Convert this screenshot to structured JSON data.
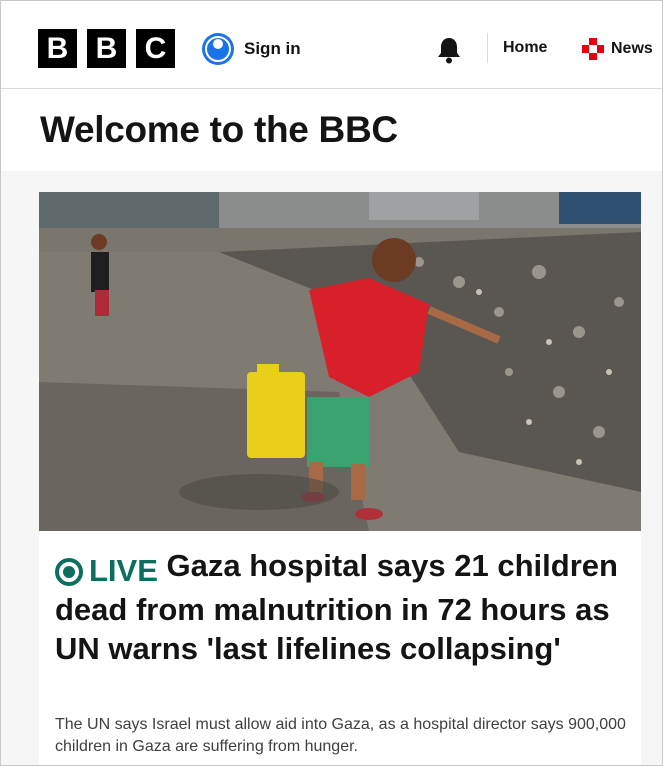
{
  "header": {
    "logo": [
      "B",
      "B",
      "C"
    ],
    "sign_in_label": "Sign in",
    "nav_home": "Home",
    "nav_news": "News",
    "icons": {
      "avatar": "user-icon",
      "bell": "notification-bell-icon",
      "news": "news-cross-icon"
    }
  },
  "welcome": {
    "title": "Welcome to the BBC"
  },
  "story": {
    "live_label": "LIVE",
    "headline": "Gaza hospital says 21 children dead from malnutrition in 72 hours as UN warns 'last lifelines collapsing'",
    "summary": "The UN says Israel must allow aid into Gaza, as a hospital director says 900,000 children in Gaza are suffering from hunger."
  },
  "colors": {
    "accent_live": "#0b6e5f",
    "sign_in_blue": "#1a73e8",
    "news_red": "#e3000f"
  }
}
